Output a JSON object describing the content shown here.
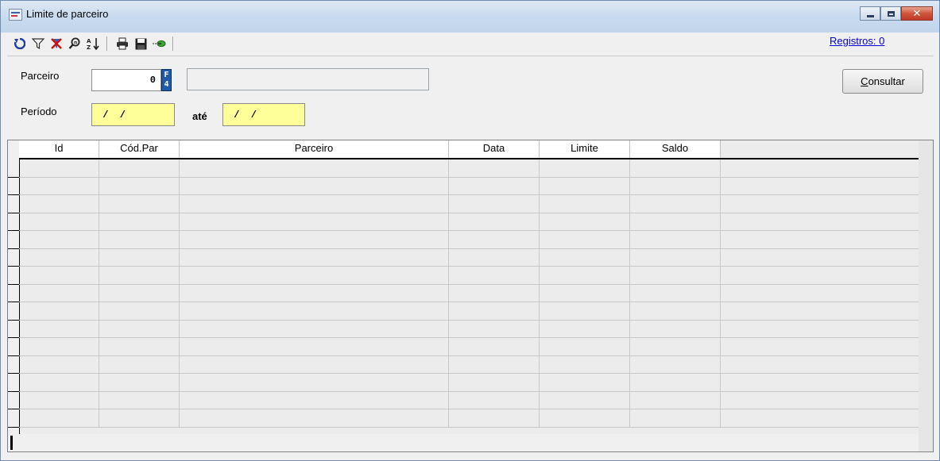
{
  "window": {
    "title": "Limite de parceiro"
  },
  "window_controls": {
    "minimize": "",
    "maximize": "",
    "close": "✕"
  },
  "toolbar": {
    "icons": [
      "refresh-icon",
      "filter-icon",
      "clear-filter-icon",
      "search-icon",
      "sort-icon",
      "print-icon",
      "save-icon",
      "export-icon"
    ]
  },
  "registros": {
    "label": "Registros: 0"
  },
  "form": {
    "parceiro_label": "Parceiro",
    "parceiro_code": "0",
    "f4_label": "F4",
    "parceiro_name": "",
    "periodo_label": "Período",
    "periodo_start": " /  /",
    "ate_label": "até",
    "periodo_end": " /  /",
    "consultar_label": "Consultar"
  },
  "grid": {
    "columns": [
      "Id",
      "Cód.Par",
      "Parceiro",
      "Data",
      "Limite",
      "Saldo"
    ],
    "rows": []
  },
  "colors": {
    "accent_link": "#0000cc",
    "date_field": "#ffff99",
    "f4_button": "#1e5aa8"
  }
}
